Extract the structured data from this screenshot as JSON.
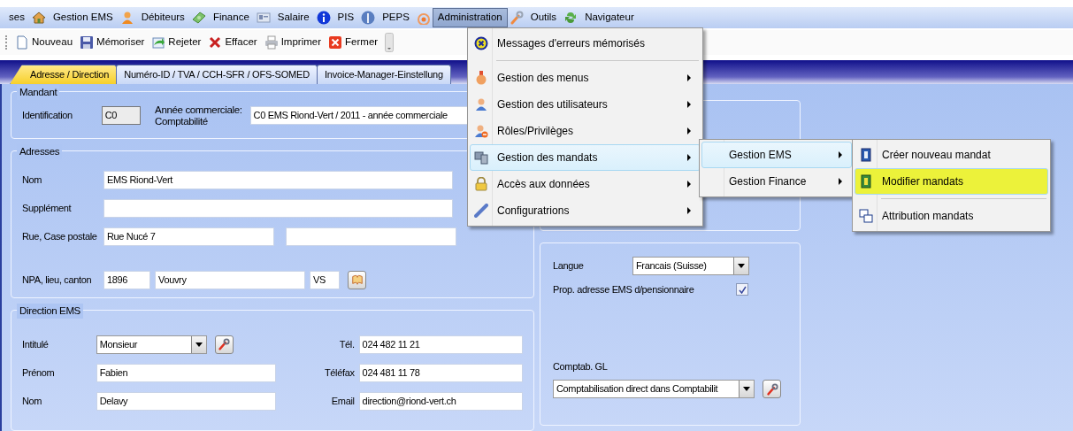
{
  "menubar": [
    {
      "label": "ses",
      "selected": false
    },
    {
      "label": "Gestion EMS",
      "selected": false
    },
    {
      "label": "Débiteurs",
      "selected": false
    },
    {
      "label": "Finance",
      "selected": false
    },
    {
      "label": "Salaire",
      "selected": false
    },
    {
      "label": "PIS",
      "selected": false
    },
    {
      "label": "PEPS",
      "selected": false
    },
    {
      "label": "Administration",
      "selected": true
    },
    {
      "label": "Outils",
      "selected": false
    },
    {
      "label": "Navigateur",
      "selected": false
    }
  ],
  "toolbar": [
    "Nouveau",
    "Mémoriser",
    "Rejeter",
    "Effacer",
    "Imprimer",
    "Fermer"
  ],
  "tabs": [
    {
      "label": "Adresse / Direction",
      "selected": true
    },
    {
      "label": "Numéro-ID / TVA / CCH-SFR / OFS-SOMED",
      "selected": false
    },
    {
      "label": "Invoice-Manager-Einstellung",
      "selected": false
    }
  ],
  "mandant": {
    "legend": "Mandant",
    "id_label": "Identification",
    "id_value": "C0",
    "id_readonly": true,
    "year_label": [
      "Année commerciale:",
      "Comptabilité"
    ],
    "year_value": "C0 EMS Riond-Vert / 2011 - année commerciale"
  },
  "adresses": {
    "legend": "Adresses",
    "rows": [
      {
        "label": "Nom",
        "fields": [
          {
            "kind": "text",
            "value": "EMS Riond-Vert"
          }
        ]
      },
      {
        "label": "Supplément",
        "fields": [
          {
            "kind": "text"
          }
        ]
      },
      {
        "label": "Rue, Case postale",
        "fields": [
          {
            "kind": "text",
            "value": "Rue Nucé 7"
          },
          {
            "kind": "text"
          }
        ]
      },
      {
        "label": "NPA, lieu, canton",
        "fields": [
          {
            "kind": "text",
            "value": "1896"
          },
          {
            "kind": "text",
            "value": "Vouvry"
          },
          {
            "kind": "text",
            "value": "VS"
          },
          {
            "kind": "button"
          }
        ]
      }
    ]
  },
  "direction": {
    "legend": "Direction EMS",
    "rows": [
      {
        "label": "Intitulé",
        "fields": [
          {
            "kind": "combo",
            "value": "Monsieur"
          },
          {
            "kind": "button"
          }
        ],
        "right_label": "Tél.",
        "right_value": "024 482 11 21"
      },
      {
        "label": "Prénom",
        "fields": [
          {
            "kind": "text",
            "value": "Fabien"
          }
        ],
        "right_label": "Téléfax",
        "right_value": "024 481 11 78"
      },
      {
        "label": "Nom",
        "fields": [
          {
            "kind": "text",
            "value": "Delavy"
          }
        ],
        "right_label": "Email",
        "right_value": "direction@riond-vert.ch"
      }
    ]
  },
  "options": {
    "language_label": "Langue",
    "language_value": "Francais (Suisse)",
    "checkbox_label": "Prop. adresse EMS d/pensionnaire",
    "checked": true,
    "gl_label": "Comptab. GL",
    "gl_value": "Comptabilisation direct dans Comptabilit"
  },
  "admin_menu": [
    {
      "label": "Messages d'erreurs mémorisés",
      "submenu": false,
      "selected": false,
      "separator_after": true
    },
    {
      "label": "Gestion des menus",
      "submenu": true,
      "selected": false
    },
    {
      "label": "Gestion des utilisateurs",
      "submenu": true,
      "selected": false
    },
    {
      "label": "Rôles/Privilèges",
      "submenu": true,
      "selected": false
    },
    {
      "label": "Gestion des mandats",
      "submenu": true,
      "selected": true
    },
    {
      "label": "Accès aux données",
      "submenu": true,
      "selected": false
    },
    {
      "label": "Configuratrions",
      "submenu": true,
      "selected": false
    }
  ],
  "mandats_menu": [
    {
      "label": "Gestion EMS",
      "submenu": true,
      "selected": true
    },
    {
      "label": "Gestion Finance",
      "submenu": true,
      "selected": false
    }
  ],
  "ems_menu": [
    {
      "label": "Créer nouveau mandat",
      "selected": false,
      "highlighted": false
    },
    {
      "label": "Modifier mandats",
      "selected": true,
      "highlighted": true,
      "separator_after": true
    },
    {
      "label": "Attribution mandats",
      "selected": false,
      "highlighted": false
    }
  ]
}
